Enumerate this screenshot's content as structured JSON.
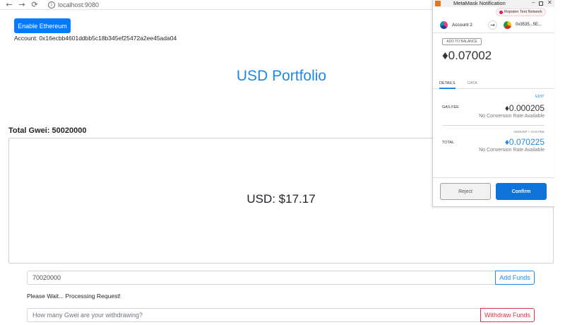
{
  "browser": {
    "back_glyph": "←",
    "forward_glyph": "→",
    "reload_glyph": "⟳",
    "info_glyph": "i",
    "url": "localhost:9080"
  },
  "app": {
    "enable_label": "Enable Ethereum",
    "account_text": "Account: 0x16ecbb4601ddbb5c18b345ef25472a2ee45ada04",
    "title": "USD Portfolio",
    "total_gwei": "Total Gwei: 50020000",
    "usd_value": "USD: $17.17",
    "add_input_value": "70020000",
    "add_label": "Add Funds",
    "status_message": "Please Wait... Processing Request!",
    "withdraw_placeholder": "How many Gwei are your withdrawing?",
    "withdraw_label": "Withdraw Funds"
  },
  "metamask": {
    "window_title": "MetaMask Notification",
    "minimize_glyph": "–",
    "close_glyph": "✕",
    "network": "Ropsten Test Network",
    "account_name": "Account 2",
    "arrow_glyph": "→",
    "to_address": "0x3535...5E...",
    "add_balance_label": "ADD TO BALANCE",
    "amount": "♦0.07002",
    "tabs": {
      "details": "DETAILS",
      "data": "DATA"
    },
    "edit_label": "EDIT",
    "gas_fee_label": "GAS FEE",
    "gas_fee_value": "♦0.000205",
    "gas_fee_sub": "No Conversion Rate Available",
    "total_caption": "AMOUNT + GAS FEE",
    "total_label": "TOTAL",
    "total_value": "♦0.070225",
    "total_sub": "No Conversion Rate Available",
    "reject_label": "Reject",
    "confirm_label": "Confirm"
  },
  "colors": {
    "primary": "#007bff",
    "title_blue": "#1e88e5",
    "danger": "#dc3545",
    "metamask_confirm": "#0f73d9",
    "network_dot": "#e91550"
  }
}
